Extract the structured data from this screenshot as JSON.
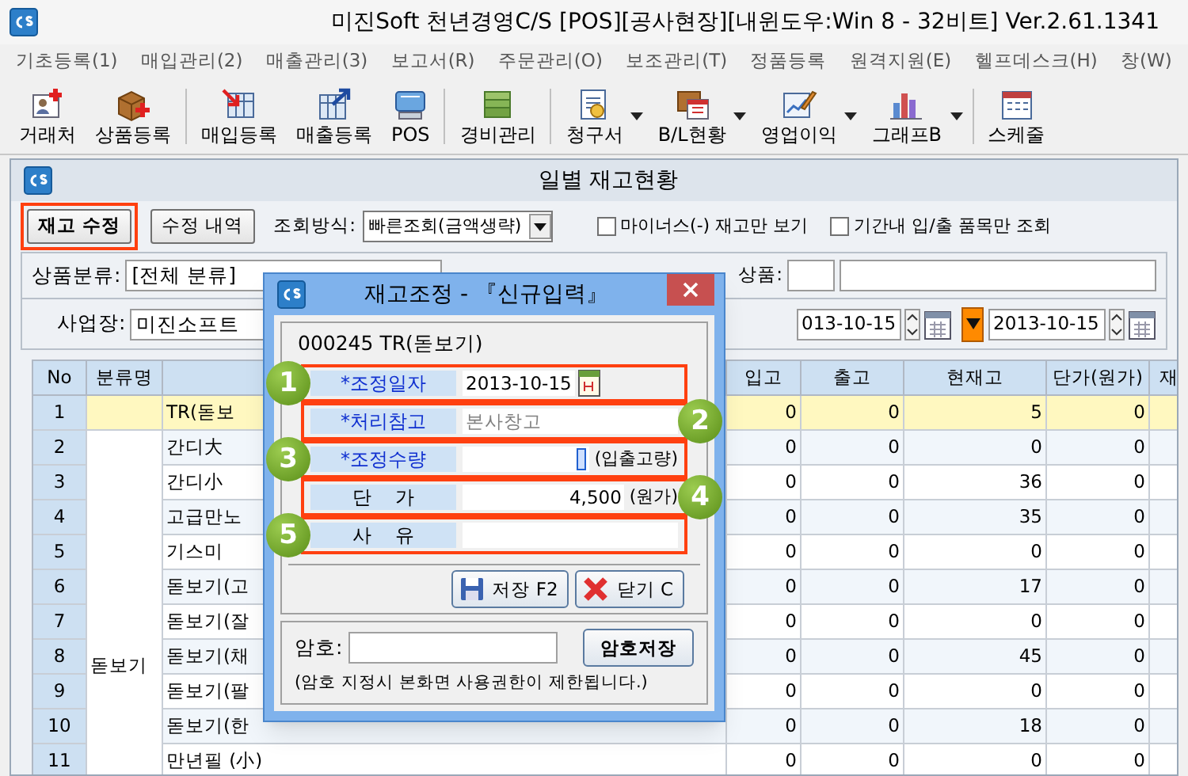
{
  "window": {
    "title": "미진Soft 천년경영C/S [POS][공사현장][내윈도우:Win 8 - 32비트] Ver.2.61.1341"
  },
  "menu": [
    "기초등록(1)",
    "매입관리(2)",
    "매출관리(3)",
    "보고서(R)",
    "주문관리(O)",
    "보조관리(T)",
    "정품등록",
    "원격지원(E)",
    "헬프데스크(H)",
    "창(W)"
  ],
  "toolbar": [
    {
      "label": "거래처",
      "dropdown": false,
      "separator_before": false
    },
    {
      "label": "상품등록",
      "dropdown": false,
      "separator_before": false
    },
    {
      "label": "매입등록",
      "dropdown": false,
      "separator_before": true
    },
    {
      "label": "매출등록",
      "dropdown": false,
      "separator_before": false
    },
    {
      "label": "POS",
      "dropdown": false,
      "separator_before": false
    },
    {
      "label": "경비관리",
      "dropdown": false,
      "separator_before": true
    },
    {
      "label": "청구서",
      "dropdown": true,
      "separator_before": true
    },
    {
      "label": "B/L현황",
      "dropdown": true,
      "separator_before": false
    },
    {
      "label": "영업이익",
      "dropdown": true,
      "separator_before": false
    },
    {
      "label": "그래프B",
      "dropdown": true,
      "separator_before": false
    },
    {
      "label": "스케줄",
      "dropdown": false,
      "separator_before": true
    }
  ],
  "child_window": {
    "title": "일별 재고현황",
    "buttons": [
      {
        "label": "재고 수정",
        "highlighted": true
      },
      {
        "label": "수정 내역",
        "highlighted": false
      }
    ],
    "query_mode": {
      "label": "조회방식:",
      "value": "빠른조회(금액생략)"
    },
    "checkboxes": [
      {
        "label": "마이너스(-) 재고만 보기",
        "checked": false
      },
      {
        "label": "기간내 입/출 품목만 조회",
        "checked": false
      }
    ],
    "category": {
      "label": "상품분류:",
      "value": "[전체 분류]"
    },
    "product": {
      "label": "상품:"
    },
    "site": {
      "label": "사업장:",
      "value": "미진소프트"
    },
    "date_from": "013-10-15",
    "date_to": "2013-10-15"
  },
  "table": {
    "columns": [
      {
        "label": "No"
      },
      {
        "label": "분류명"
      },
      {},
      {
        "label": "입고"
      },
      {
        "label": "출고"
      },
      {
        "label": "현재고"
      },
      {
        "label": "단가(원가)"
      },
      {
        "label": "재"
      }
    ],
    "group": "돋보기",
    "rows": [
      {
        "no": "1",
        "name": "TR(돋보",
        "in": "0",
        "out": "0",
        "stock": "5",
        "price": "0",
        "selected": true
      },
      {
        "no": "2",
        "name": "간디大",
        "in": "0",
        "out": "0",
        "stock": "0",
        "price": "0",
        "selected": false
      },
      {
        "no": "3",
        "name": "간디小",
        "in": "0",
        "out": "0",
        "stock": "36",
        "price": "0",
        "selected": false
      },
      {
        "no": "4",
        "name": "고급만노",
        "in": "0",
        "out": "0",
        "stock": "35",
        "price": "0",
        "selected": false
      },
      {
        "no": "5",
        "name": "기스미",
        "in": "0",
        "out": "0",
        "stock": "0",
        "price": "0",
        "selected": false
      },
      {
        "no": "6",
        "name": "돋보기(고",
        "in": "0",
        "out": "0",
        "stock": "17",
        "price": "0",
        "selected": false
      },
      {
        "no": "7",
        "name": "돋보기(잘",
        "in": "0",
        "out": "0",
        "stock": "0",
        "price": "0",
        "selected": false
      },
      {
        "no": "8",
        "name": "돋보기(채",
        "in": "0",
        "out": "0",
        "stock": "45",
        "price": "0",
        "selected": false
      },
      {
        "no": "9",
        "name": "돋보기(팔",
        "in": "0",
        "out": "0",
        "stock": "0",
        "price": "0",
        "selected": false
      },
      {
        "no": "10",
        "name": "돋보기(한",
        "in": "0",
        "out": "0",
        "stock": "18",
        "price": "0",
        "selected": false
      },
      {
        "no": "11",
        "name": "만년필 (小)",
        "in": "0",
        "out": "0",
        "stock": "0",
        "price": "0",
        "selected": false
      }
    ]
  },
  "dialog": {
    "title": "재고조정 - 『신규입력』",
    "product": "000245 TR(돋보기)",
    "fields": [
      {
        "label": "*조정일자",
        "value": "2013-10-15",
        "kind": "date",
        "required": true,
        "highlighted": true,
        "callout": {
          "number": "1",
          "right_side": false
        }
      },
      {
        "label": "*처리참고",
        "placeholder": "본사창고",
        "kind": "text",
        "required": true,
        "highlighted": true,
        "callout": {
          "number": "2",
          "right_side": true
        }
      },
      {
        "label": "*조정수량",
        "kind": "number",
        "suffix": "(입출고량)",
        "required": true,
        "highlighted": true,
        "callout": {
          "number": "3",
          "right_side": false
        }
      },
      {
        "label": "단    가",
        "value": "4,500",
        "kind": "number",
        "suffix": "(원가)",
        "required": false,
        "highlighted": true,
        "callout": {
          "number": "4",
          "right_side": true
        }
      },
      {
        "label": "사    유",
        "kind": "text",
        "required": false,
        "highlighted": true,
        "callout": {
          "number": "5",
          "right_side": false
        }
      }
    ],
    "buttons": [
      {
        "label": "저장 F2",
        "kind": "save"
      },
      {
        "label": "닫기 C",
        "kind": "close"
      }
    ],
    "password": {
      "label": "암호:",
      "button": "암호저장",
      "note": "(암호 지정시 본화면 사용권한이 제한됩니다.)"
    }
  }
}
